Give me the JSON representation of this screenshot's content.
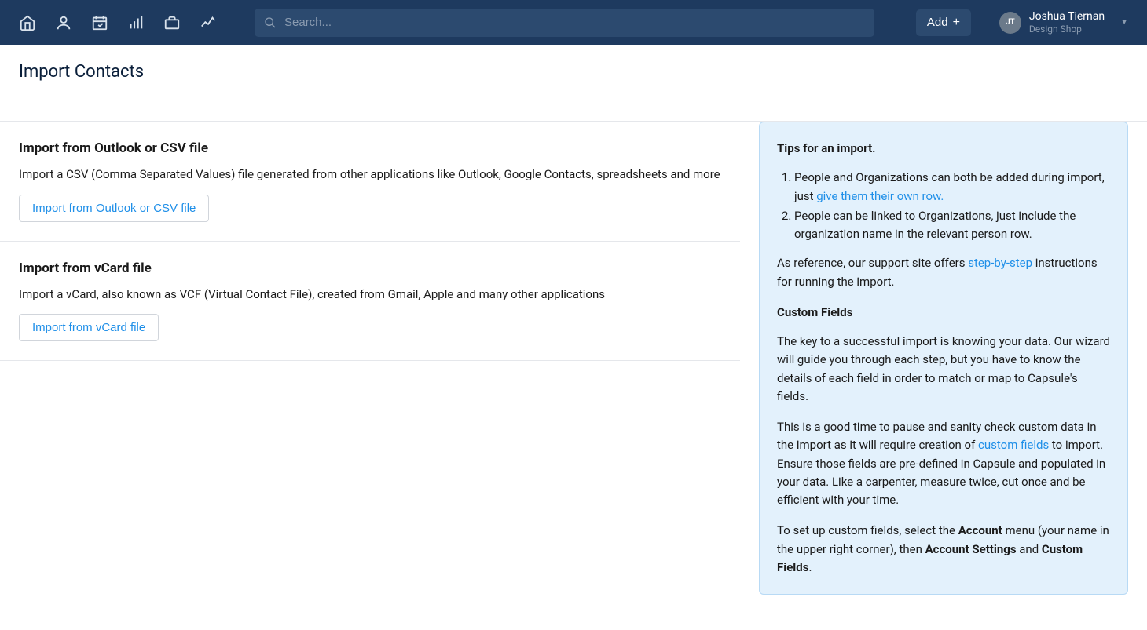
{
  "header": {
    "search_placeholder": "Search...",
    "add_label": "Add",
    "user_initials": "JT",
    "user_name": "Joshua Tiernan",
    "user_org": "Design Shop"
  },
  "page": {
    "title": "Import Contacts"
  },
  "sections": {
    "csv": {
      "heading": "Import from Outlook or CSV file",
      "description": "Import a CSV (Comma Separated Values) file generated from other applications like Outlook, Google Contacts, spreadsheets and more",
      "button_label": "Import from Outlook or CSV file"
    },
    "vcard": {
      "heading": "Import from vCard file",
      "description": "Import a vCard, also known as VCF (Virtual Contact File), created from Gmail, Apple and many other applications",
      "button_label": "Import from vCard file"
    }
  },
  "tips": {
    "heading": "Tips for an import.",
    "list_item_1_prefix": "People and Organizations can both be added during import, just ",
    "list_item_1_link": "give them their own row.",
    "list_item_2": "People can be linked to Organizations, just include the organization name in the relevant person row.",
    "reference_prefix": "As reference, our support site offers ",
    "reference_link": "step-by-step",
    "reference_suffix": " instructions for running the import.",
    "custom_fields_heading": "Custom Fields",
    "custom_fields_p1": "The key to a successful import is knowing your data. Our wizard will guide you through each step, but you have to know the details of each field in order to match or map to Capsule's fields.",
    "custom_fields_p2_prefix": "This is a good time to pause and sanity check custom data in the import as it will require creation of ",
    "custom_fields_p2_link": "custom fields",
    "custom_fields_p2_suffix": " to import. Ensure those fields are pre-defined in Capsule and populated in your data. Like a carpenter, measure twice, cut once and be efficient with your time.",
    "custom_fields_p3_prefix": "To set up custom fields, select the ",
    "custom_fields_p3_bold1": "Account",
    "custom_fields_p3_mid": " menu (your name in the upper right corner), then ",
    "custom_fields_p3_bold2": "Account Settings",
    "custom_fields_p3_and": " and ",
    "custom_fields_p3_bold3": "Custom Fields",
    "custom_fields_p3_end": "."
  }
}
